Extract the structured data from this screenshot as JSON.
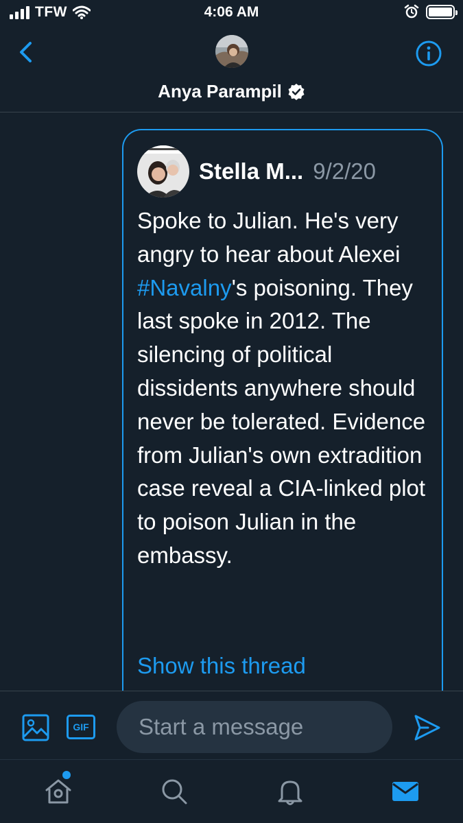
{
  "status_bar": {
    "carrier": "TFW",
    "time": "4:06 AM",
    "battery_level": 1.0
  },
  "header": {
    "back_icon": "chevron-left-icon",
    "contact_name": "Anya Parampil",
    "verified": true,
    "info_icon": "info-icon"
  },
  "message": {
    "author": "Stella M...",
    "date": "9/2/20",
    "text_before": "Spoke to Julian. He's very angry to hear about Alexei ",
    "hashtag": "#Navalny",
    "text_after": "'s poisoning. They last spoke in 2012. The silencing of political dissidents anywhere should never be tolerated. Evidence from Julian's own extradition case reveal a CIA-linked plot to poison Julian in the embassy.",
    "show_thread": "Show this thread"
  },
  "composer": {
    "gif_label": "GIF",
    "placeholder": "Start a message"
  },
  "tabs": [
    {
      "icon": "home-icon",
      "has_dot": true
    },
    {
      "icon": "search-icon"
    },
    {
      "icon": "notifications-icon"
    },
    {
      "icon": "messages-icon",
      "active": true
    }
  ],
  "colors": {
    "background": "#15202b",
    "accent": "#1d9bf0",
    "secondary_text": "#8b98a5",
    "divider": "#38444d"
  }
}
